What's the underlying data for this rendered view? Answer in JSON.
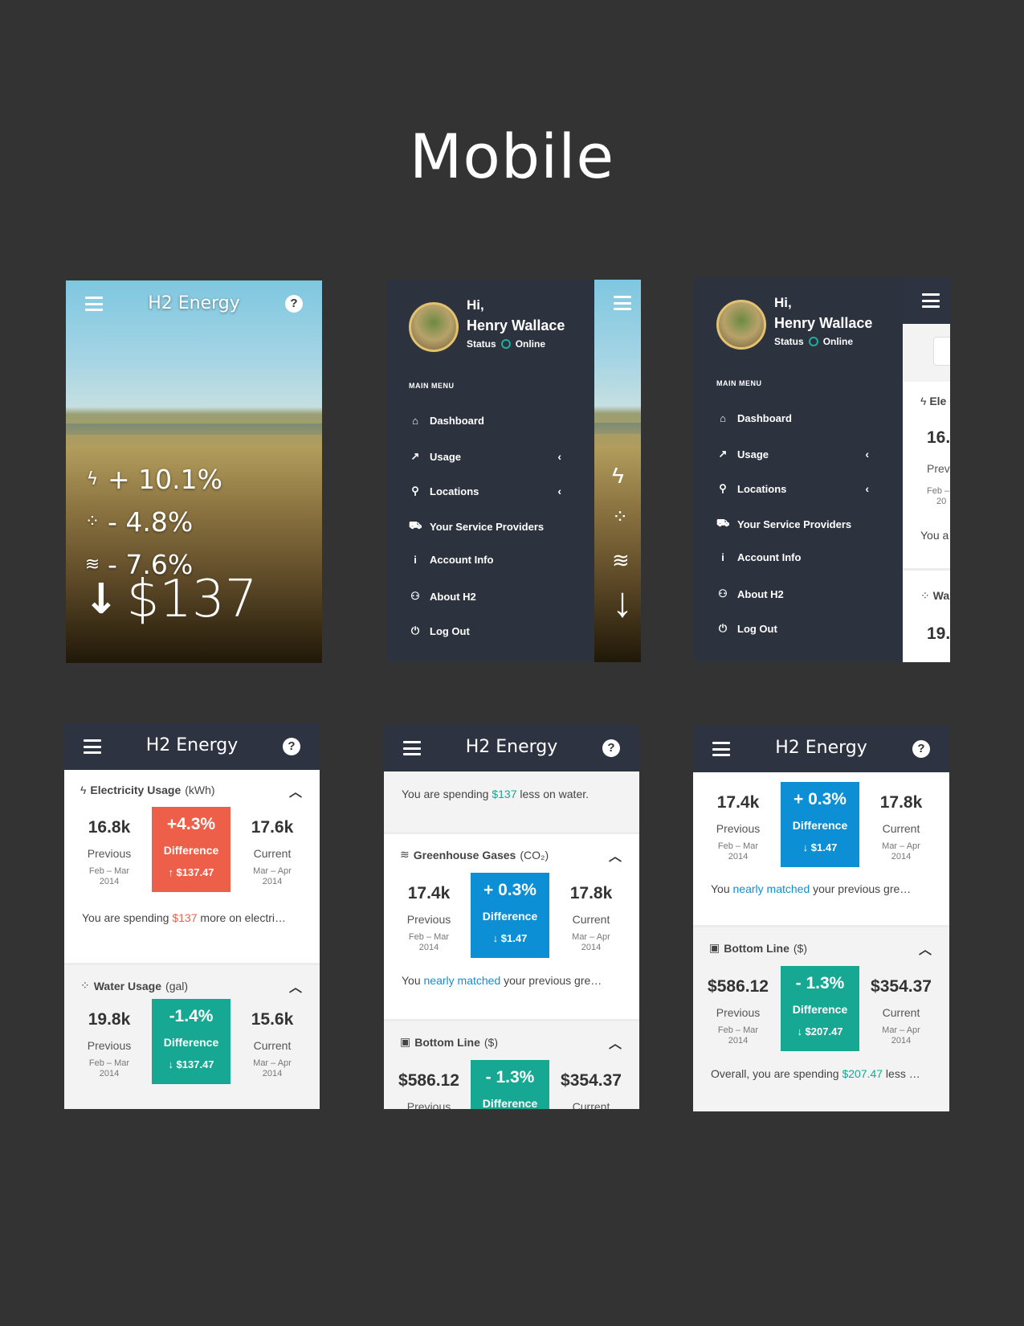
{
  "page": {
    "title": "Mobile"
  },
  "app": {
    "title": "H2 Energy"
  },
  "hero": {
    "stats": [
      {
        "icon": "bolt-icon",
        "glyph": "ϟ",
        "value": "+ 10.1%"
      },
      {
        "icon": "drops-icon",
        "glyph": "ᐞ",
        "value": "- 4.8%"
      },
      {
        "icon": "gas-icon",
        "glyph": "≋",
        "value": "- 7.6%"
      }
    ],
    "total_arrow": "↓",
    "total": "$137"
  },
  "drawer": {
    "greeting": "Hi,",
    "user_name": "Henry Wallace",
    "status_label": "Status",
    "status_value": "Online",
    "section": "MAIN MENU",
    "items": [
      {
        "label": "Dashboard",
        "icon": "home-icon",
        "glyph": "⌂"
      },
      {
        "label": "Usage",
        "icon": "chart-icon",
        "glyph": "↗",
        "chevron": "‹"
      },
      {
        "label": "Locations",
        "icon": "map-pin-icon",
        "glyph": "⚲",
        "chevron": "‹"
      },
      {
        "label": "Your Service Providers",
        "icon": "providers-icon",
        "glyph": "⛟"
      },
      {
        "label": "Account Info",
        "icon": "info-icon",
        "glyph": "i"
      },
      {
        "label": "About H2",
        "icon": "about-icon",
        "glyph": "⚇"
      },
      {
        "label": "Log Out",
        "icon": "power-icon",
        "glyph": "⏻"
      }
    ]
  },
  "peek3": {
    "bolt": "ϟ",
    "title": "Ele",
    "value": "16.",
    "label": "Prev",
    "date": "Feb –",
    "date2": "20",
    "note": "You a",
    "water": "Wa",
    "water_value": "19."
  },
  "sections": {
    "electricity": {
      "title": "Electricity Usage",
      "unit": "(kWh)",
      "previous": "16.8k",
      "difference": "+4.3%",
      "current": "17.6k",
      "previous_label": "Previous",
      "difference_label": "Difference",
      "current_label": "Current",
      "previous_date": "Feb – Mar",
      "previous_year": "2014",
      "current_date": "Mar – Apr",
      "current_year": "2014",
      "money": "↑ $137.47",
      "note_pre": "You are spending ",
      "note_hl": "$137",
      "note_post": " more on electri…"
    },
    "water": {
      "title": "Water Usage",
      "unit": "(gal)",
      "previous": "19.8k",
      "difference": "-1.4%",
      "current": "15.6k",
      "previous_label": "Previous",
      "difference_label": "Difference",
      "current_label": "Current",
      "previous_date": "Feb – Mar",
      "previous_year": "2014",
      "current_date": "Mar – Apr",
      "current_year": "2014",
      "money": "↓ $137.47",
      "note_pre": "You are spending ",
      "note_hl": "$137",
      "note_post": " less on water."
    },
    "greenhouse": {
      "title": "Greenhouse Gases",
      "unit": "(CO₂)",
      "previous": "17.4k",
      "difference": "+ 0.3%",
      "current": "17.8k",
      "previous_label": "Previous",
      "difference_label": "Difference",
      "current_label": "Current",
      "previous_date": "Feb – Mar",
      "previous_year": "2014",
      "current_date": "Mar – Apr",
      "current_year": "2014",
      "money": "↓ $1.47",
      "note_pre": "You ",
      "note_hl": "nearly matched",
      "note_post": " your previous gre…"
    },
    "bottom": {
      "title": "Bottom Line",
      "unit": "($)",
      "previous": "$586.12",
      "difference": "- 1.3%",
      "current": "$354.37",
      "previous_label": "Previous",
      "difference_label": "Difference",
      "current_label": "Current",
      "previous_date": "Feb – Mar",
      "previous_year": "2014",
      "current_date": "Mar – Apr",
      "current_year": "2014",
      "money": "↓ $207.47",
      "note_pre": "Overall, you are spending ",
      "note_hl": "$207.47",
      "note_post": " less …"
    }
  },
  "colors": {
    "red": "#ee5f4a",
    "teal": "#16a893",
    "blue": "#0d8fd6",
    "bar": "#2d3340"
  }
}
